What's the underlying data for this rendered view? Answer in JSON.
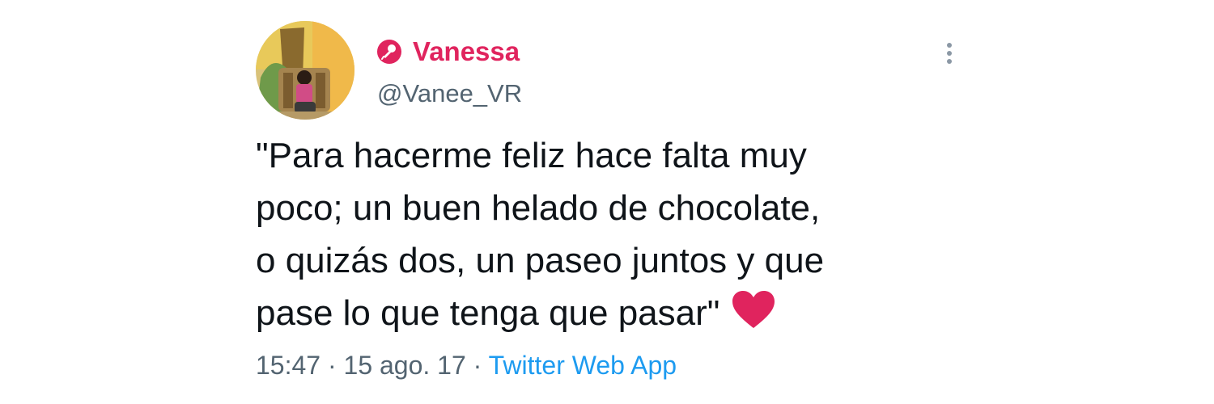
{
  "author": {
    "display_name": "Vanessa",
    "handle": "@Vanee_VR"
  },
  "tweet": {
    "lines": [
      "\"Para hacerme feliz hace falta muy",
      "poco; un buen helado de chocolate,",
      "o quizás dos, un paseo juntos y que",
      "pase lo que tenga que pasar\""
    ],
    "emoji": "red-heart-icon"
  },
  "meta": {
    "time": "15:47",
    "separator": "·",
    "date": "15 ago. 17",
    "source": "Twitter Web App"
  },
  "icons": {
    "badge": "microphone-icon",
    "more": "more-vertical-icon"
  },
  "colors": {
    "name_accent": "#e0245e",
    "link": "#1d9bf0",
    "secondary_text": "#536471",
    "heart": "#e0245e"
  }
}
